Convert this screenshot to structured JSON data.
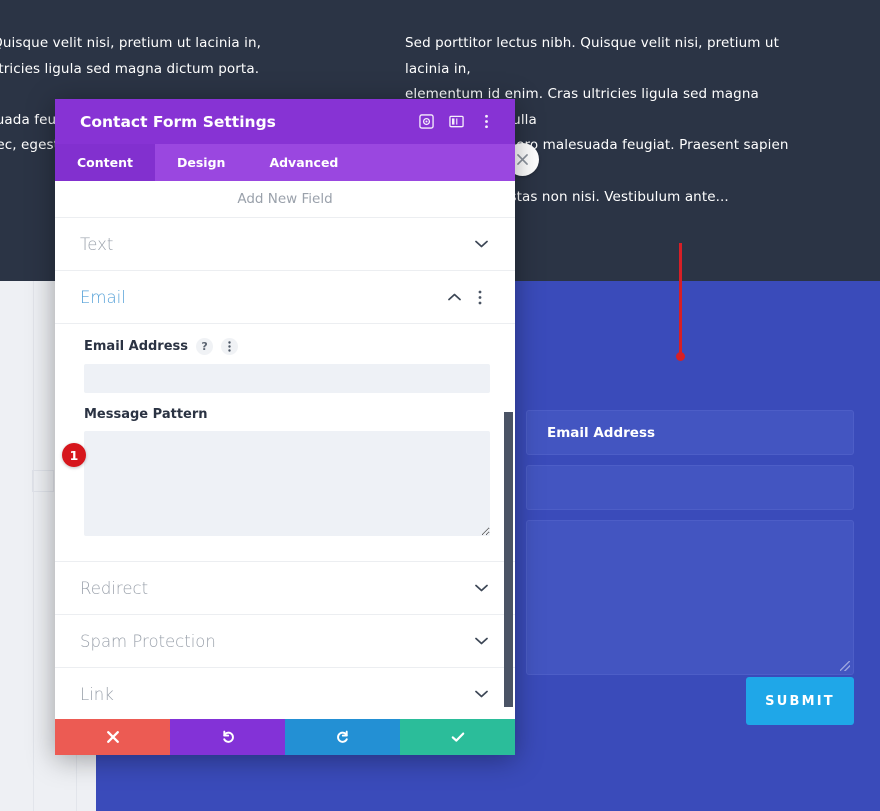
{
  "background": {
    "left_column_text": "s nibh. Quisque velit nisi, pretium ut lacinia in,\n. Cras ultricies ligula sed magna dictum porta. Nulla\no malesuada feugiat. Praesent sapien massa,\nesque nec, egestas non nisi. Vestibulum ante...",
    "right_column_text": "Sed porttitor lectus nibh. Quisque velit nisi, pretium ut lacinia in,\nelementum id enim. Cras ultricies ligula sed magna dictum porta. Nulla\nquis lorem ut libero malesuada feugiat. Praesent sapien massa,\nesque nec, egestas non nisi. Vestibulum ante...",
    "dark_bg_color": "#2b3445",
    "blue_panel_color": "#3a4bba",
    "light_panel_color": "#eef0f4"
  },
  "preview": {
    "email_field_label": "Email Address",
    "blank_field_label": "",
    "message_field_label": "",
    "submit_label": "SUBMIT",
    "submit_color": "#1fa7e8"
  },
  "marker": {
    "color": "#d61f26"
  },
  "page_close_button": {
    "icon": "close-icon"
  },
  "modal": {
    "title": "Contact Form Settings",
    "header_color": "#8733d4",
    "header_icons": [
      {
        "name": "target-icon"
      },
      {
        "name": "layout-columns-icon"
      },
      {
        "name": "kebab-menu-icon"
      }
    ],
    "tabs": [
      {
        "label": "Content",
        "active": true
      },
      {
        "label": "Design",
        "active": false
      },
      {
        "label": "Advanced",
        "active": false
      }
    ],
    "add_new_field_label": "Add New Field",
    "sections": [
      {
        "label": "Text",
        "open": false
      },
      {
        "label": "Email",
        "open": true
      },
      {
        "label": "Redirect",
        "open": false
      },
      {
        "label": "Spam Protection",
        "open": false
      },
      {
        "label": "Link",
        "open": false
      }
    ],
    "email_section": {
      "email_address": {
        "label": "Email Address",
        "value": "",
        "placeholder": "",
        "help_icon": "?",
        "badge": "1"
      },
      "message_pattern": {
        "label": "Message Pattern",
        "value": "",
        "placeholder": ""
      }
    },
    "footer_buttons": [
      {
        "name": "cancel-button",
        "icon": "close-icon",
        "color": "#ec5b53"
      },
      {
        "name": "undo-button",
        "icon": "undo-icon",
        "color": "#8332d7"
      },
      {
        "name": "redo-button",
        "icon": "redo-icon",
        "color": "#2390d4"
      },
      {
        "name": "save-button",
        "icon": "check-icon",
        "color": "#2bbd9a"
      }
    ]
  }
}
